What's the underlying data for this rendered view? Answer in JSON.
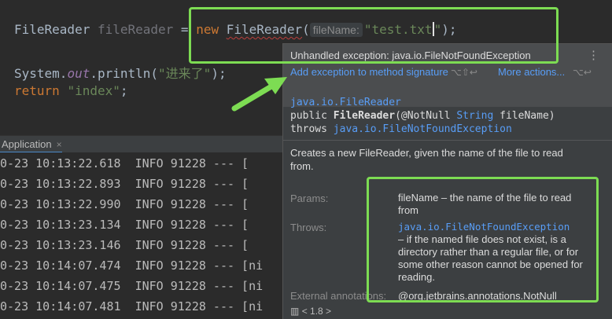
{
  "editor": {
    "line1": {
      "type_name": "FileReader",
      "var_name": "fileReader",
      "assign": " = ",
      "new_kw": "new",
      "ctor": "FileReader",
      "open_paren": "(",
      "param_hint": "fileName:",
      "arg": "\"test.txt",
      "close_quote": "\"",
      "close": ");"
    },
    "line2": {
      "prefix": "System.",
      "field": "out",
      "method": ".println(",
      "arg": "\"进来了\"",
      "close": ");"
    },
    "line3": {
      "kw": "return",
      "arg": "\"index\"",
      "close": ";"
    }
  },
  "run_panel": {
    "tab_label": "Application",
    "close_glyph": "×"
  },
  "console": {
    "lines": [
      "0-23 10:13:22.618  INFO 91228 --- [",
      "0-23 10:13:22.893  INFO 91228 --- [",
      "0-23 10:13:22.990  INFO 91228 --- [",
      "0-23 10:13:23.134  INFO 91228 --- [",
      "0-23 10:13:23.146  INFO 91228 --- [",
      "0-23 10:14:07.474  INFO 91228 --- [ni",
      "0-23 10:14:07.475  INFO 91228 --- [ni",
      "0-23 10:14:07.481  INFO 91228 --- [ni"
    ]
  },
  "popup": {
    "error_title": "Unhandled exception: java.io.FileNotFoundException",
    "more_glyph": "⋮",
    "primary_action": "Add exception to method signature",
    "primary_shortcut": "⌥⇧↩",
    "more_actions": "More actions...",
    "more_shortcut": "⌥↩",
    "signature": {
      "class_link": "java.io.FileReader",
      "line2_mod": "public ",
      "line2_name": "FileReader",
      "line2_open": "(@NotNull ",
      "line2_type": "String",
      "line2_rest": " fileName)",
      "line3_kw": "throws ",
      "line3_link": "java.io.FileNotFoundException"
    },
    "description": "Creates a new FileReader, given the name of the file to read from.",
    "params_label": "Params:",
    "params_value": "fileName – the name of the file to read from",
    "throws_label": "Throws:",
    "throws_link": "java.io.FileNotFoundException",
    "throws_text": "– if the named file does not exist, is a directory rather than a regular file, or for some other reason cannot be opened for reading.",
    "external_label": "External annotations:",
    "external_value": "@org.jetbrains.annotations.NotNull",
    "jdk_version": "< 1.8 >"
  },
  "colors": {
    "annotation_green": "#7ddc53",
    "link_blue": "#589df6"
  }
}
